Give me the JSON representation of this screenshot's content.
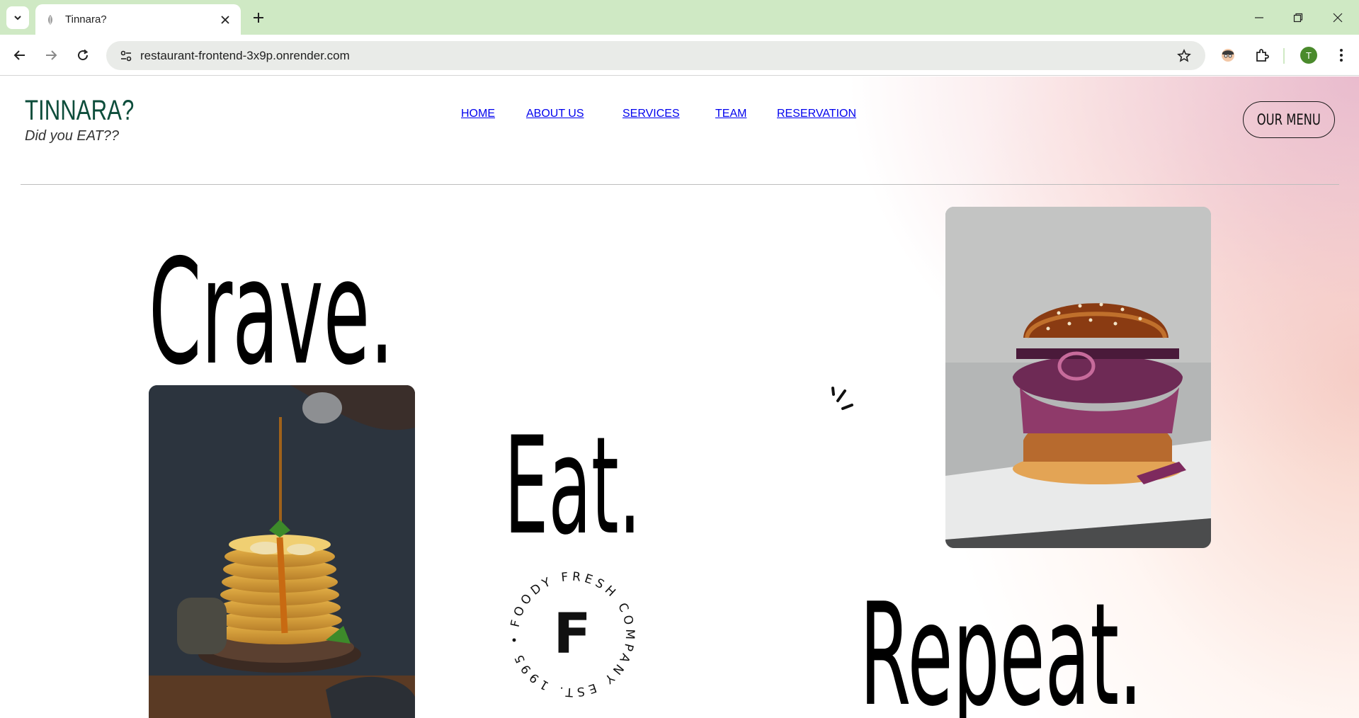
{
  "browser": {
    "tab_title": "Tinnara?",
    "url": "restaurant-frontend-3x9p.onrender.com",
    "profile_initial": "T"
  },
  "site": {
    "brand_title": "TINNARA?",
    "brand_subtitle": "Did you EAT??",
    "nav": [
      "HOME",
      "ABOUT US",
      "SERVICES",
      "TEAM",
      "RESERVATION"
    ],
    "cta": "OUR MENU"
  },
  "hero": {
    "word1": "Crave.",
    "word2": "Eat.",
    "word3": "Repeat."
  },
  "stamp": {
    "letter": "F",
    "ring_text": "FOODY FRESH COMPANY EST. 1995 •"
  },
  "icons": {
    "favicon": "leaf-favicon-icon",
    "tab_search": "chevron-down-icon",
    "tab_close": "close-icon",
    "new_tab": "plus-icon",
    "back": "back-arrow-icon",
    "forward": "forward-arrow-icon",
    "reload": "reload-icon",
    "site_info": "tune-icon",
    "bookmark": "star-icon",
    "extension_avatar": "extension-face-icon",
    "extensions": "puzzle-icon",
    "more": "kebab-menu-icon"
  },
  "colors": {
    "tab_strip": "#cfe9c4",
    "brand_green": "#0d4d3b",
    "gradient_pink": "#e2aac4",
    "gradient_peach": "#f0aa96"
  }
}
